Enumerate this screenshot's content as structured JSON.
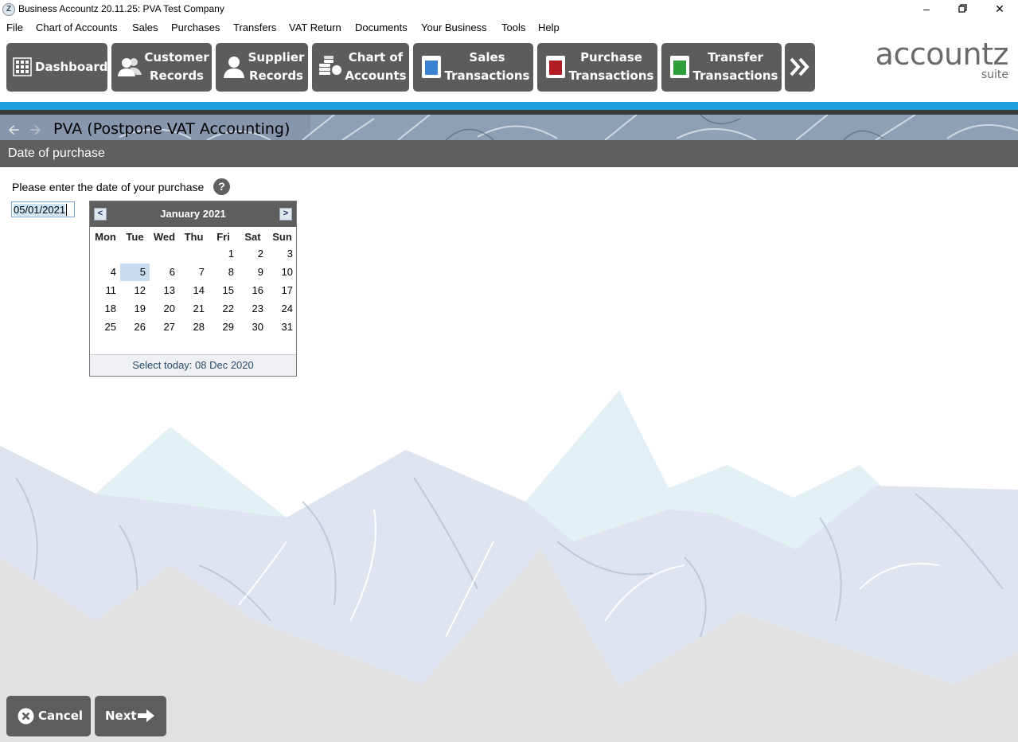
{
  "window": {
    "title": "Business Accountz 20.11.25: PVA Test Company",
    "app_icon": "Z",
    "controls": [
      "minimize-icon",
      "restore-icon",
      "close-icon"
    ]
  },
  "menu": [
    "File",
    "Chart of Accounts",
    "Sales",
    "Purchases",
    "Transfers",
    "VAT Return",
    "Documents",
    "Your Business",
    "Tools",
    "Help"
  ],
  "toolbar": {
    "dashboard": "Dashboard",
    "customer_1": "Customer",
    "customer_2": "Records",
    "supplier_1": "Supplier",
    "supplier_2": "Records",
    "coa_1": "Chart of",
    "coa_2": "Accounts",
    "sales_1": "Sales",
    "sales_2": "Transactions",
    "purchase_1": "Purchase",
    "purchase_2": "Transactions",
    "transfer_1": "Transfer",
    "transfer_2": "Transactions",
    "more_icon": "double-chevron-right-icon"
  },
  "logo": {
    "main": "accountz",
    "sub": "suite"
  },
  "header": {
    "title": "PVA (Postpone VAT Accounting)",
    "subtitle": "Date of purchase"
  },
  "form": {
    "prompt": "Please enter the date of your purchase",
    "help": "?",
    "date_value": "05/01/2021"
  },
  "calendar": {
    "month": "January 2021",
    "prev": "<",
    "next": ">",
    "weekdays": [
      "Mon",
      "Tue",
      "Wed",
      "Thu",
      "Fri",
      "Sat",
      "Sun"
    ],
    "first_weekday_index": 4,
    "days_in_month": 31,
    "selected_day": 5,
    "footer": "Select today: 08 Dec 2020"
  },
  "buttons": {
    "cancel": "Cancel",
    "next": "Next"
  },
  "colors": {
    "accent_blue": "#1d9fdc",
    "button_grey": "#5c5c5c",
    "sales_book": "#3b83d1",
    "purchase_book": "#b01c22",
    "transfer_book": "#2f9e3b"
  }
}
